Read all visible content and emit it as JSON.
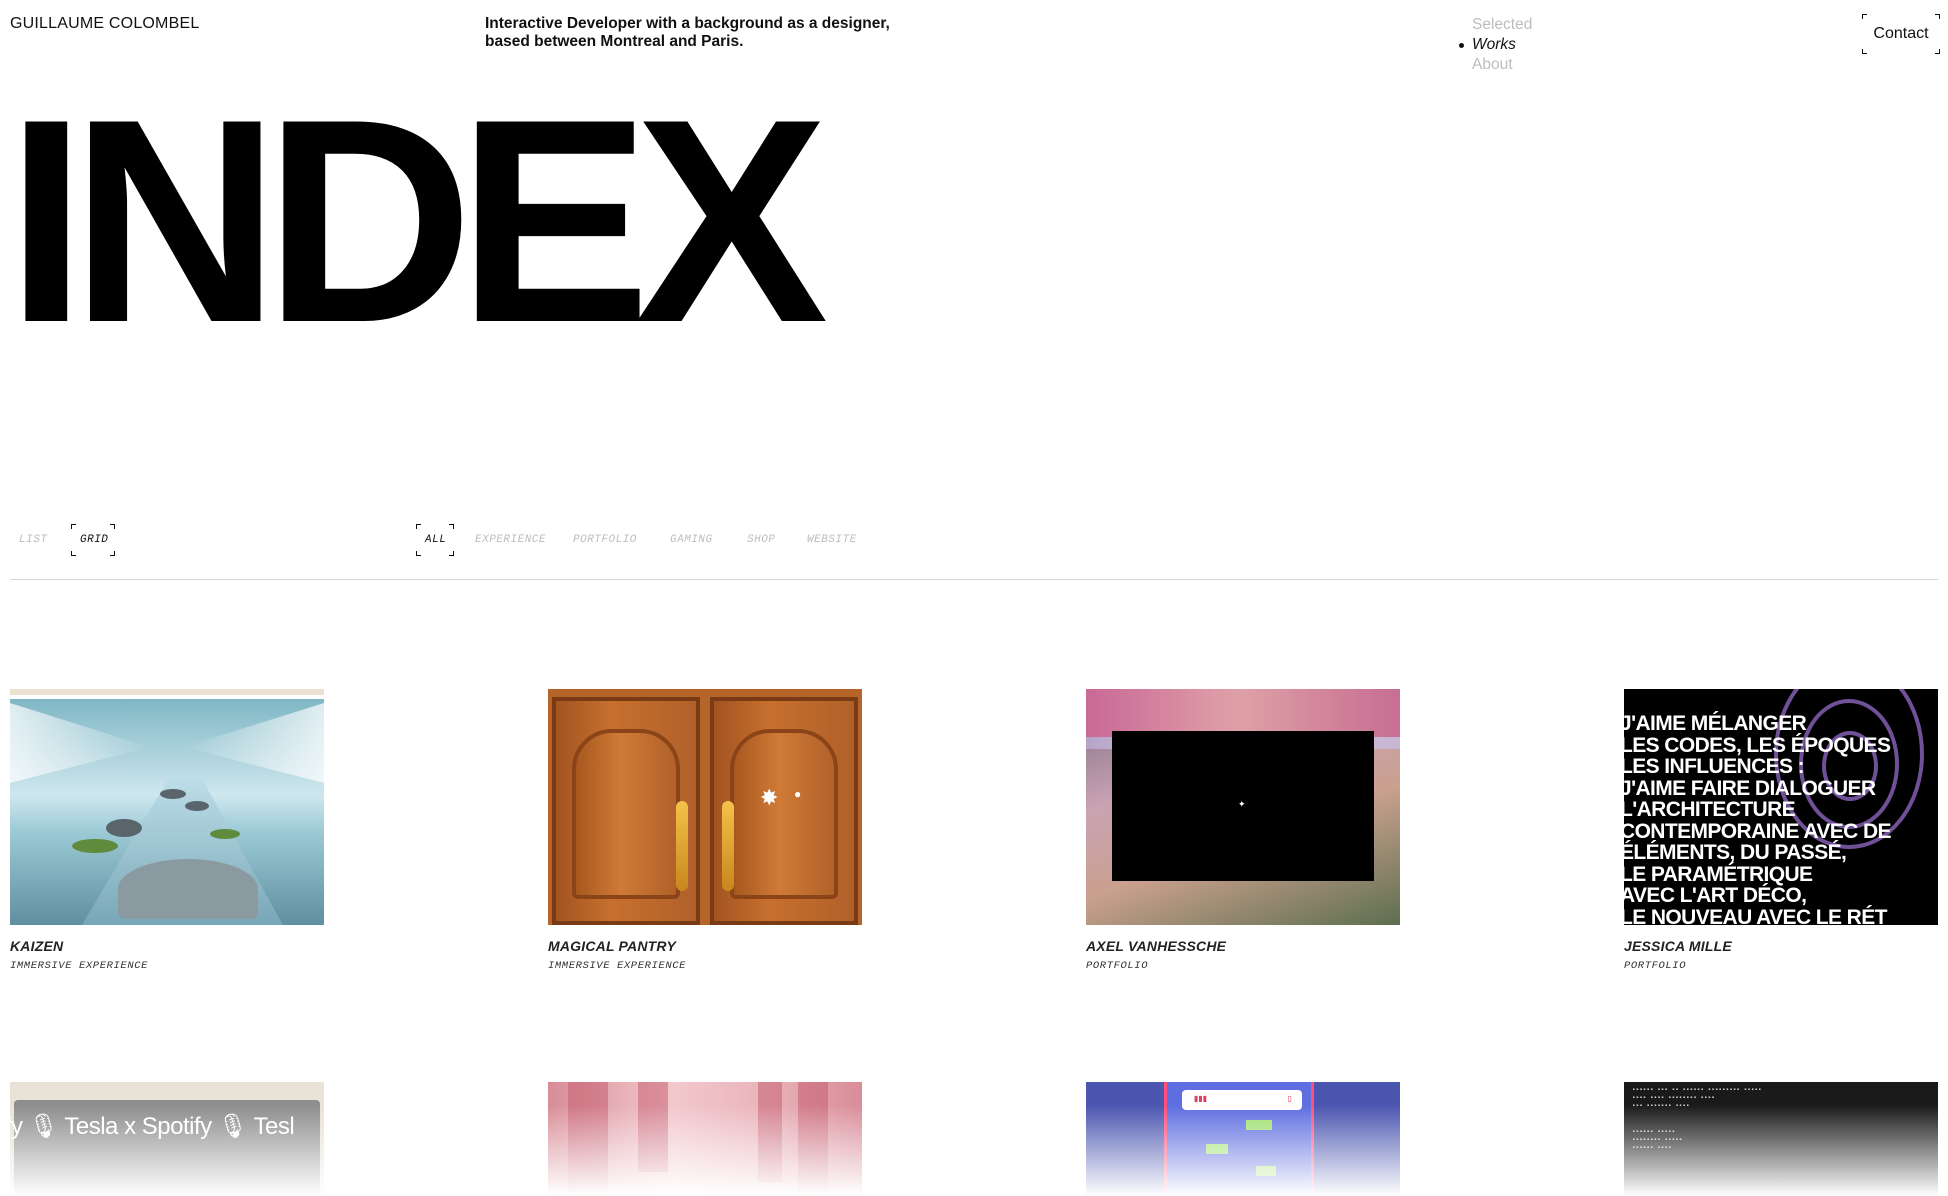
{
  "header": {
    "brand": "GUILLAUME COLOMBEL",
    "tagline_line1": "Interactive Developer with a background as a designer,",
    "tagline_line2": "based between Montreal and Paris.",
    "nav": [
      {
        "label": "Selected",
        "state": "inactive"
      },
      {
        "label": "Works",
        "state": "active"
      },
      {
        "label": "About",
        "state": "inactive"
      }
    ],
    "contact_label": "Contact"
  },
  "hero": {
    "title": "INDEX"
  },
  "view_toggle": [
    {
      "label": "LIST",
      "selected": false
    },
    {
      "label": "GRID",
      "selected": true
    }
  ],
  "filters": [
    {
      "label": "ALL",
      "selected": true
    },
    {
      "label": "EXPERIENCE",
      "selected": false
    },
    {
      "label": "PORTFOLIO",
      "selected": false
    },
    {
      "label": "GAMING",
      "selected": false
    },
    {
      "label": "SHOP",
      "selected": false
    },
    {
      "label": "WEBSITE",
      "selected": false
    }
  ],
  "projects": [
    {
      "title": "KAIZEN",
      "category": "IMMERSIVE EXPERIENCE"
    },
    {
      "title": "MAGICAL PANTRY",
      "category": "IMMERSIVE EXPERIENCE"
    },
    {
      "title": "AXEL VANHESSCHE",
      "category": "PORTFOLIO"
    },
    {
      "title": "JESSICA MILLE",
      "category": "PORTFOLIO"
    }
  ],
  "thumb_text": {
    "jessica_lines": [
      "J'AIME   MÉLANGER",
      "LES CODES,   LES ÉPOQUES",
      "  LES INFLUENCES :",
      "  J'AIME   FAIRE DIALOGUER",
      "L'ARCHITECTURE",
      "CONTEMPORAINE   AVEC DE",
      "  ÉLÉMENTS,  DU PASSÉ,",
      "LE    PARAMÉTRIQUE",
      "       AVEC L'ART DÉCO,",
      "  LE NOUVEAU AVEC LE RÉT"
    ],
    "tesla": "ify 🎙 Tesla x Spotify 🎙 Tesl"
  },
  "colors": {
    "accent": "#111111",
    "muted": "#bdbdbd",
    "divider": "#d7d7d7",
    "background": "#ffffff"
  }
}
